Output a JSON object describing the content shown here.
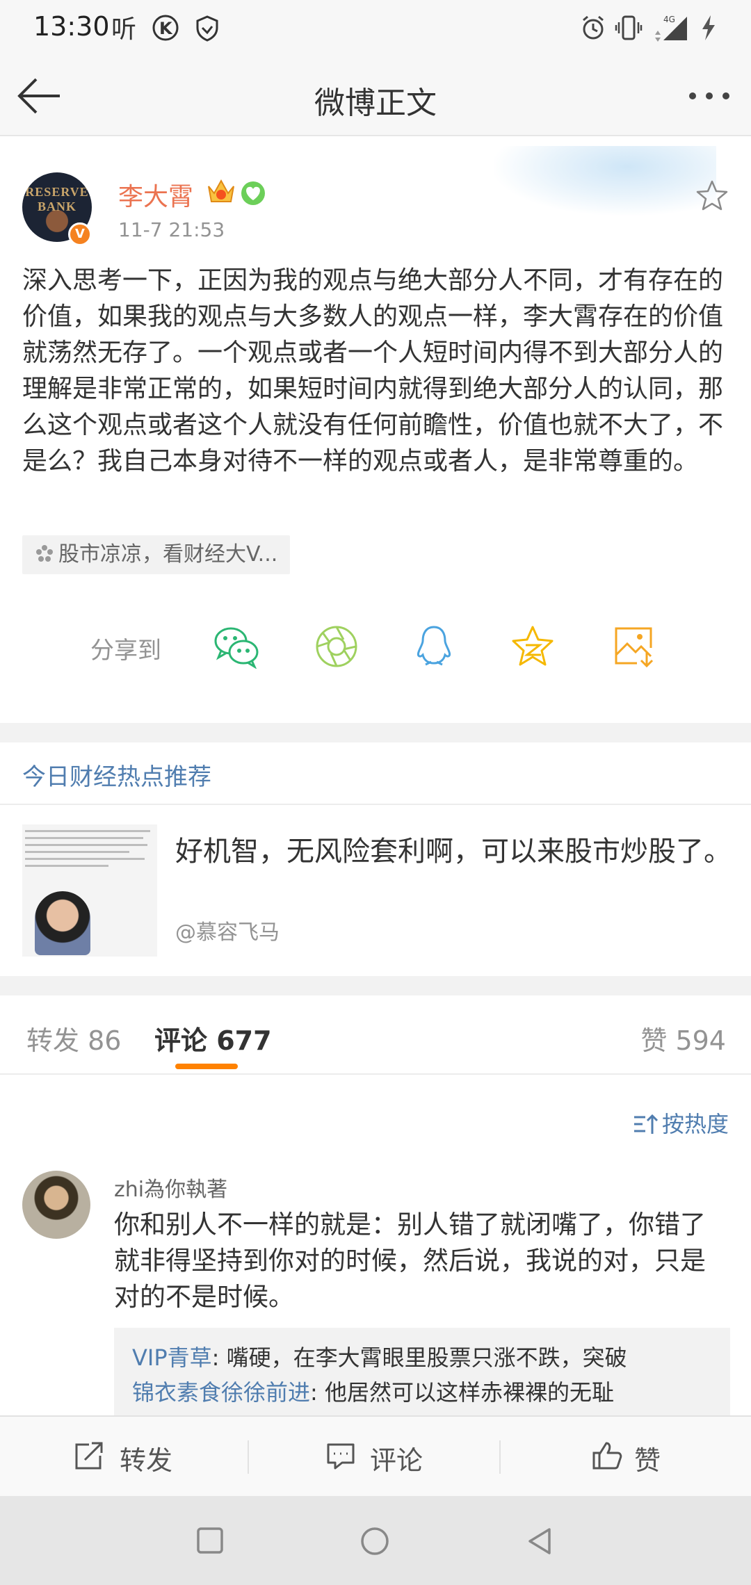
{
  "status_bar": {
    "time": "13:30",
    "icons": [
      "listen-icon",
      "k-icon",
      "shield-icon",
      "alarm-icon",
      "vibrate-icon",
      "signal-4g-icon",
      "charging-icon"
    ]
  },
  "nav": {
    "title": "微博正文",
    "back_icon": "arrow-left-icon",
    "more_icon": "more-dots-icon"
  },
  "post": {
    "author": "李大霄",
    "time": "11-7 21:53",
    "avatar_text": "RESERVE BANK",
    "verified_badge": "V",
    "text": "深入思考一下，正因为我的观点与绝大部分人不同，才有存在的价值，如果我的观点与大多数人的观点一样，李大霄存在的价值就荡然无存了。一个观点或者一个人短时间内得不到大部分人的理解是非常正常的，如果短时间内就得到绝大部分人的认同，那么这个观点或者这个人就没有任何前瞻性，价值也就不大了，不是么？我自己本身对待不一样的观点或者人，是非常尊重的。",
    "topic": "股市凉凉，看财经大V..."
  },
  "share": {
    "label": "分享到",
    "targets": [
      "wechat-icon",
      "moments-icon",
      "qq-icon",
      "qzone-star-icon",
      "save-image-icon"
    ]
  },
  "recommend": {
    "header": "今日财经热点推荐",
    "title": "好机智，无风险套利啊，可以来股市炒股了。",
    "user": "@慕容飞马"
  },
  "tabs": [
    {
      "label": "转发 86"
    },
    {
      "label": "评论 677"
    },
    {
      "label": "赞 594"
    }
  ],
  "sort_label": "按热度",
  "comment": {
    "user": "zhi為你執著",
    "text": "你和别人不一样的就是：别人错了就闭嘴了，你错了就非得坚持到你对的时候，然后说，我说的对，只是对的不是时候。",
    "replies": [
      {
        "name": "VIP青草",
        "text": ": 嘴硬，在李大霄眼里股票只涨不跌，突破"
      },
      {
        "name": "锦衣素食徐徐前进",
        "text": ": 他居然可以这样赤裸裸的无耻"
      }
    ]
  },
  "bottom_bar": {
    "repost": "转发",
    "comment": "评论",
    "like": "赞"
  },
  "colors": {
    "link_blue": "#507daf",
    "author_orange": "#eb7350",
    "tab_accent": "#ff8200"
  }
}
